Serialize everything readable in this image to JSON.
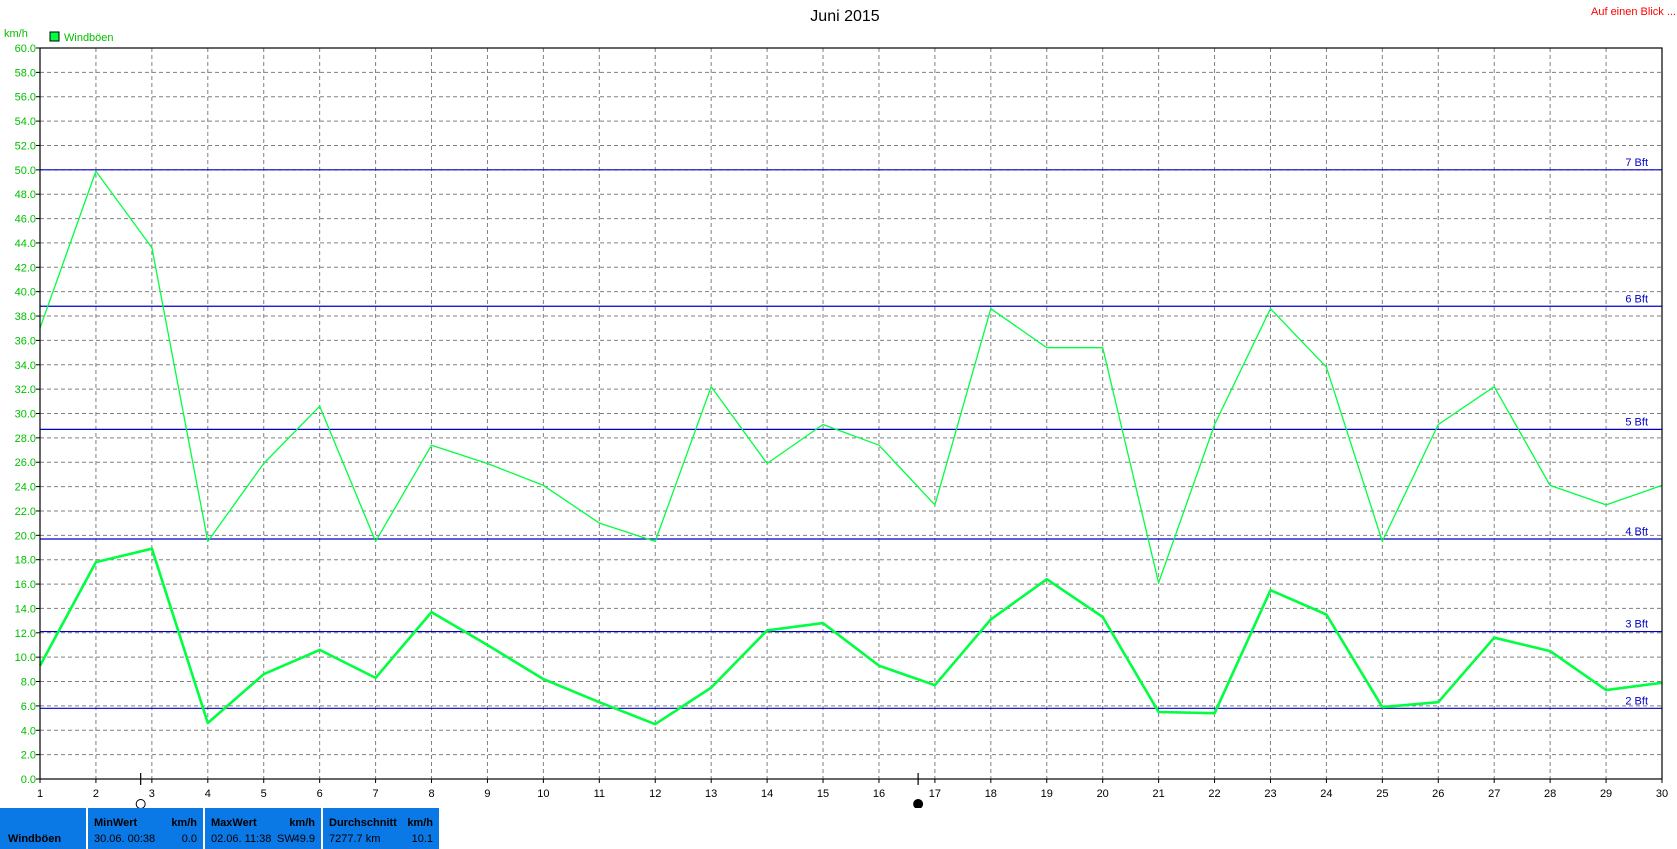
{
  "header": {
    "title": "Juni 2015",
    "overview_link": "Auf einen Blick ..."
  },
  "colors": {
    "series": "#00ff40",
    "grid": "#808080",
    "bft_lines": "#0000cc",
    "footer_bg": "#0a79e6",
    "link": "#ff0000"
  },
  "chart_data": {
    "type": "line",
    "title": "Juni 2015",
    "unit_label": "km/h",
    "legend": [
      "Windböen"
    ],
    "legend_position": "top-left",
    "grid": true,
    "x": [
      1,
      2,
      3,
      4,
      5,
      6,
      7,
      8,
      9,
      10,
      11,
      12,
      13,
      14,
      15,
      16,
      17,
      18,
      19,
      20,
      21,
      22,
      23,
      24,
      25,
      26,
      27,
      28,
      29,
      30
    ],
    "xlim": [
      1,
      30
    ],
    "ylim": [
      0,
      60
    ],
    "ytick_step": 2,
    "yticks": [
      "0.0",
      "2.0",
      "4.0",
      "6.0",
      "8.0",
      "10.0",
      "12.0",
      "14.0",
      "16.0",
      "18.0",
      "20.0",
      "22.0",
      "24.0",
      "26.0",
      "28.0",
      "30.0",
      "32.0",
      "34.0",
      "36.0",
      "38.0",
      "40.0",
      "42.0",
      "44.0",
      "46.0",
      "48.0",
      "50.0",
      "52.0",
      "54.0",
      "56.0",
      "58.0",
      "60.0"
    ],
    "series": [
      {
        "name": "Windböen",
        "role": "max",
        "values": [
          37.0,
          49.9,
          43.6,
          19.5,
          25.9,
          30.6,
          19.5,
          27.4,
          25.9,
          24.1,
          21.0,
          19.5,
          32.2,
          25.9,
          29.1,
          27.4,
          22.5,
          38.6,
          35.4,
          35.4,
          16.1,
          29.1,
          38.6,
          33.8,
          19.5,
          29.1,
          32.2,
          24.1,
          22.5,
          24.1
        ]
      },
      {
        "role": "average",
        "values": [
          9.3,
          17.8,
          18.9,
          4.6,
          8.6,
          10.6,
          8.3,
          13.7,
          11.0,
          8.2,
          6.3,
          4.5,
          7.5,
          12.2,
          12.8,
          9.3,
          7.7,
          13.1,
          16.4,
          13.3,
          5.5,
          5.4,
          15.5,
          13.5,
          5.9,
          6.3,
          11.6,
          10.5,
          7.3,
          7.9
        ]
      }
    ],
    "bft_lines": [
      {
        "label": "2 Bft",
        "value": 5.8
      },
      {
        "label": "3 Bft",
        "value": 12.1
      },
      {
        "label": "4 Bft",
        "value": 19.7
      },
      {
        "label": "5 Bft",
        "value": 28.7
      },
      {
        "label": "6 Bft",
        "value": 38.8
      },
      {
        "label": "7 Bft",
        "value": 50.0
      }
    ],
    "moon_phases": [
      {
        "day": 2.8,
        "phase": "full-moon"
      },
      {
        "day": 16.7,
        "phase": "new-moon"
      }
    ]
  },
  "footer": {
    "label": "Windböen",
    "min": {
      "header": "MinWert",
      "unit": "km/h",
      "date": "30.06.  00:38",
      "value": "0.0"
    },
    "max": {
      "header": "MaxWert",
      "unit": "km/h",
      "date": "02.06.  11:38",
      "dir": "SW",
      "value": "49.9"
    },
    "avg": {
      "header": "Durchschnitt",
      "unit": "km/h",
      "distance": "7277.7 km",
      "value": "10.1"
    }
  }
}
